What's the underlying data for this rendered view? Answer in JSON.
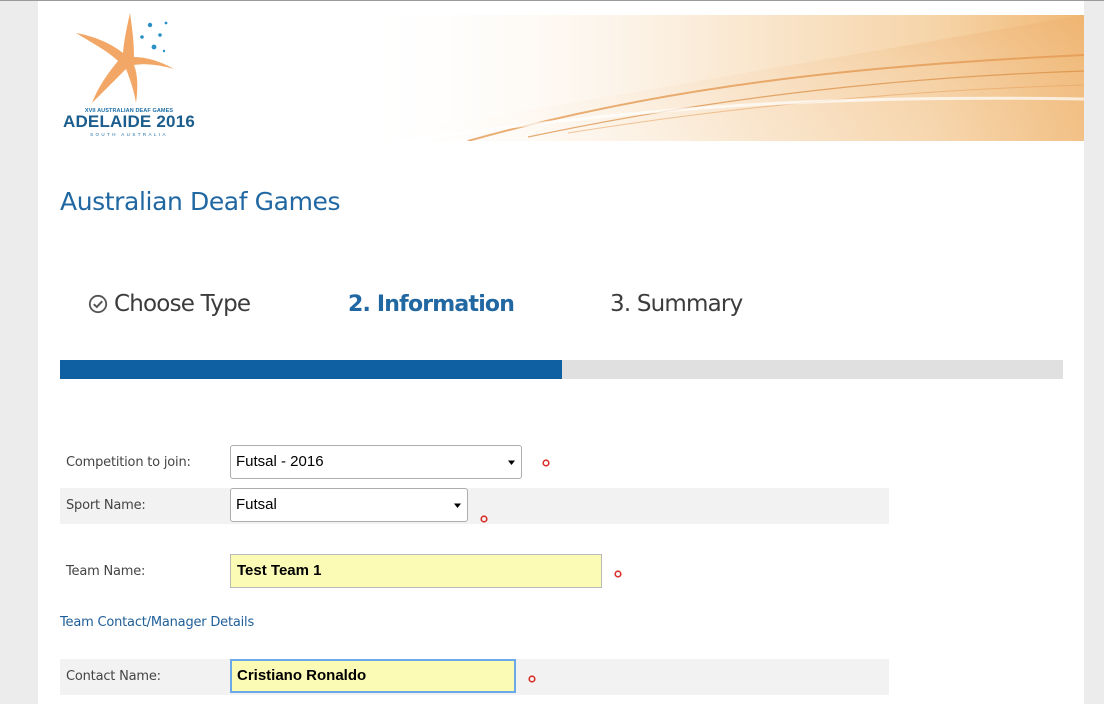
{
  "banner": {
    "logo_line1": "XVII AUSTRALIAN DEAF GAMES",
    "logo_main": "ADELAIDE 2016",
    "logo_sub": "SOUTH AUSTRALIA",
    "logo_icon": "star-figure-icon",
    "colors": {
      "brand_blue": "#1b5e8d",
      "star_orange": "#f0a060"
    }
  },
  "page": {
    "title": "Australian Deaf Games"
  },
  "steps": [
    {
      "label": "Choose Type",
      "status": "complete",
      "icon": "check-circle-icon"
    },
    {
      "label": "2. Information",
      "status": "current"
    },
    {
      "label": "3. Summary",
      "status": "upcoming"
    }
  ],
  "progress": {
    "fraction": 0.5,
    "fill_color": "#0f5fa3",
    "track_color": "#e0e0e0"
  },
  "form": {
    "competition": {
      "label": "Competition to join:",
      "value": "Futsal - 2016",
      "required": true
    },
    "sport": {
      "label": "Sport Name:",
      "value": "Futsal",
      "required": true
    },
    "team": {
      "label": "Team Name:",
      "value": "Test Team 1",
      "required": true
    },
    "section_heading": "Team Contact/Manager Details",
    "contact": {
      "label": "Contact Name:",
      "value": "Cristiano Ronaldo",
      "required": true,
      "focused": true
    },
    "required_marker_color": "#d9302c",
    "input_highlight_color": "#fbfbb6"
  }
}
